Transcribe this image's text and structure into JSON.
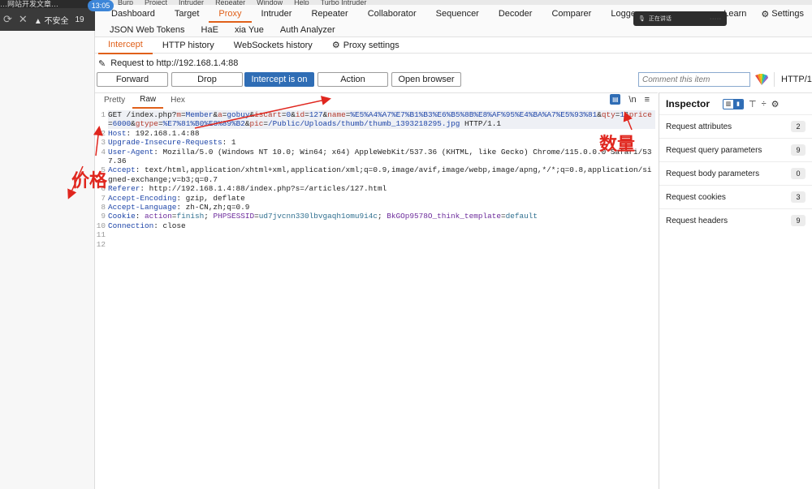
{
  "browser": {
    "top_title": "…网站开发文章…",
    "tab_back_icon": "arrow-left-icon",
    "tab_close_icon": "close-icon",
    "security_warning": "▲ 不安全",
    "url_fragment": "19",
    "clock": "13:05"
  },
  "menubar": [
    "Burp",
    "Project",
    "Intruder",
    "Repeater",
    "Window",
    "Help",
    "Turbo Intruder"
  ],
  "main_tabs": [
    "Dashboard",
    "Target",
    "Proxy",
    "Intruder",
    "Repeater",
    "Collaborator",
    "Sequencer",
    "Decoder",
    "Comparer",
    "Logger"
  ],
  "main_tabs_right": [
    "Learn"
  ],
  "settings_label": "Settings",
  "voice_overlay": "正在讲话",
  "ext_tabs": [
    "JSON Web Tokens",
    "HaE",
    "xia Yue",
    "Auth Analyzer"
  ],
  "sub_tabs": [
    "Intercept",
    "HTTP history",
    "WebSockets history"
  ],
  "proxy_settings_label": "Proxy settings",
  "request_to": "Request to http://192.168.1.4:88",
  "toolbar": {
    "forward": "Forward",
    "drop": "Drop",
    "intercept": "Intercept is on",
    "action": "Action",
    "open_browser": "Open browser",
    "comment_placeholder": "Comment this item",
    "http_version": "HTTP/1"
  },
  "editor_tabs": [
    "Pretty",
    "Raw",
    "Hex"
  ],
  "editor_icons": {
    "newline": "\\n",
    "menu": "≡"
  },
  "request_lines": [
    {
      "n": "1",
      "parts": [
        {
          "t": "GET /index.php?",
          "c": ""
        },
        {
          "t": "m",
          "c": "k-red"
        },
        {
          "t": "=",
          "c": ""
        },
        {
          "t": "Member",
          "c": "k-blue"
        },
        {
          "t": "&",
          "c": ""
        },
        {
          "t": "a",
          "c": "k-red"
        },
        {
          "t": "=",
          "c": ""
        },
        {
          "t": "gobuy",
          "c": "k-blue"
        },
        {
          "t": "&",
          "c": ""
        },
        {
          "t": "iscart",
          "c": "k-red"
        },
        {
          "t": "=",
          "c": ""
        },
        {
          "t": "0",
          "c": "k-blue"
        },
        {
          "t": "&",
          "c": ""
        },
        {
          "t": "id",
          "c": "k-red"
        },
        {
          "t": "=",
          "c": ""
        },
        {
          "t": "127",
          "c": "k-blue"
        },
        {
          "t": "&",
          "c": ""
        },
        {
          "t": "name",
          "c": "k-red"
        },
        {
          "t": "=",
          "c": ""
        },
        {
          "t": "%E5%A4%A7%E7%B1%B3%E6%B5%8B%E8%AF%95%E4%BA%A7%E5%93%81",
          "c": "k-blue"
        },
        {
          "t": "&",
          "c": ""
        },
        {
          "t": "qty",
          "c": "k-red"
        },
        {
          "t": "=",
          "c": ""
        },
        {
          "t": "1",
          "c": "k-blue"
        },
        {
          "t": "&",
          "c": ""
        },
        {
          "t": "price",
          "c": "k-red"
        },
        {
          "t": "=",
          "c": ""
        },
        {
          "t": "6000",
          "c": "k-blue"
        },
        {
          "t": "&",
          "c": ""
        },
        {
          "t": "gtype",
          "c": "k-red"
        },
        {
          "t": "=",
          "c": ""
        },
        {
          "t": "%E7%81%B0%E8%89%B2",
          "c": "k-blue"
        },
        {
          "t": "&",
          "c": ""
        },
        {
          "t": "pic",
          "c": "k-red"
        },
        {
          "t": "=",
          "c": ""
        },
        {
          "t": "/Public/Uploads/thumb/thumb_1393218295.jpg",
          "c": "k-blue"
        },
        {
          "t": " HTTP/1.1",
          "c": ""
        }
      ]
    },
    {
      "n": "2",
      "parts": [
        {
          "t": "Host",
          "c": "k-blue"
        },
        {
          "t": ": 192.168.1.4:88",
          "c": ""
        }
      ]
    },
    {
      "n": "3",
      "parts": [
        {
          "t": "Upgrade-Insecure-Requests",
          "c": "k-blue"
        },
        {
          "t": ": 1",
          "c": ""
        }
      ]
    },
    {
      "n": "4",
      "parts": [
        {
          "t": "User-Agent",
          "c": "k-blue"
        },
        {
          "t": ": Mozilla/5.0 (Windows NT 10.0; Win64; x64) AppleWebKit/537.36 (KHTML, like Gecko) Chrome/115.0.0.0 Safari/537.36",
          "c": ""
        }
      ]
    },
    {
      "n": "5",
      "parts": [
        {
          "t": "Accept",
          "c": "k-blue"
        },
        {
          "t": ": text/html,application/xhtml+xml,application/xml;q=0.9,image/avif,image/webp,image/apng,*/*;q=0.8,application/signed-exchange;v=b3;q=0.7",
          "c": ""
        }
      ]
    },
    {
      "n": "6",
      "parts": [
        {
          "t": "Referer",
          "c": "k-blue"
        },
        {
          "t": ": http://192.168.1.4:88/index.php?s=/articles/127.html",
          "c": ""
        }
      ]
    },
    {
      "n": "7",
      "parts": [
        {
          "t": "Accept-Encoding",
          "c": "k-blue"
        },
        {
          "t": ": gzip, deflate",
          "c": ""
        }
      ]
    },
    {
      "n": "8",
      "parts": [
        {
          "t": "Accept-Language",
          "c": "k-blue"
        },
        {
          "t": ": zh-CN,zh;q=0.9",
          "c": ""
        }
      ]
    },
    {
      "n": "9",
      "parts": [
        {
          "t": "Cookie",
          "c": "k-blue"
        },
        {
          "t": ": ",
          "c": ""
        },
        {
          "t": "action",
          "c": "k-purple"
        },
        {
          "t": "=",
          "c": ""
        },
        {
          "t": "finish",
          "c": "k-teal"
        },
        {
          "t": "; ",
          "c": ""
        },
        {
          "t": "PHPSESSID",
          "c": "k-purple"
        },
        {
          "t": "=",
          "c": ""
        },
        {
          "t": "ud7jvcnn330lbvgaqh1omu9i4c",
          "c": "k-teal"
        },
        {
          "t": "; ",
          "c": ""
        },
        {
          "t": "BkGOp9578O_think_template",
          "c": "k-purple"
        },
        {
          "t": "=",
          "c": ""
        },
        {
          "t": "default",
          "c": "k-teal"
        }
      ]
    },
    {
      "n": "10",
      "parts": [
        {
          "t": "Connection",
          "c": "k-blue"
        },
        {
          "t": ": close",
          "c": ""
        }
      ]
    },
    {
      "n": "11",
      "parts": []
    },
    {
      "n": "12",
      "parts": []
    }
  ],
  "inspector": {
    "title": "Inspector",
    "rows": [
      {
        "label": "Request attributes",
        "count": "2"
      },
      {
        "label": "Request query parameters",
        "count": "9"
      },
      {
        "label": "Request body parameters",
        "count": "0"
      },
      {
        "label": "Request cookies",
        "count": "3"
      },
      {
        "label": "Request headers",
        "count": "9"
      }
    ]
  },
  "annotations": {
    "price": "价格",
    "quantity": "数量"
  },
  "colors": {
    "accent": "#e0601a",
    "primary": "#2f6db5",
    "annotation": "#e0261e"
  }
}
